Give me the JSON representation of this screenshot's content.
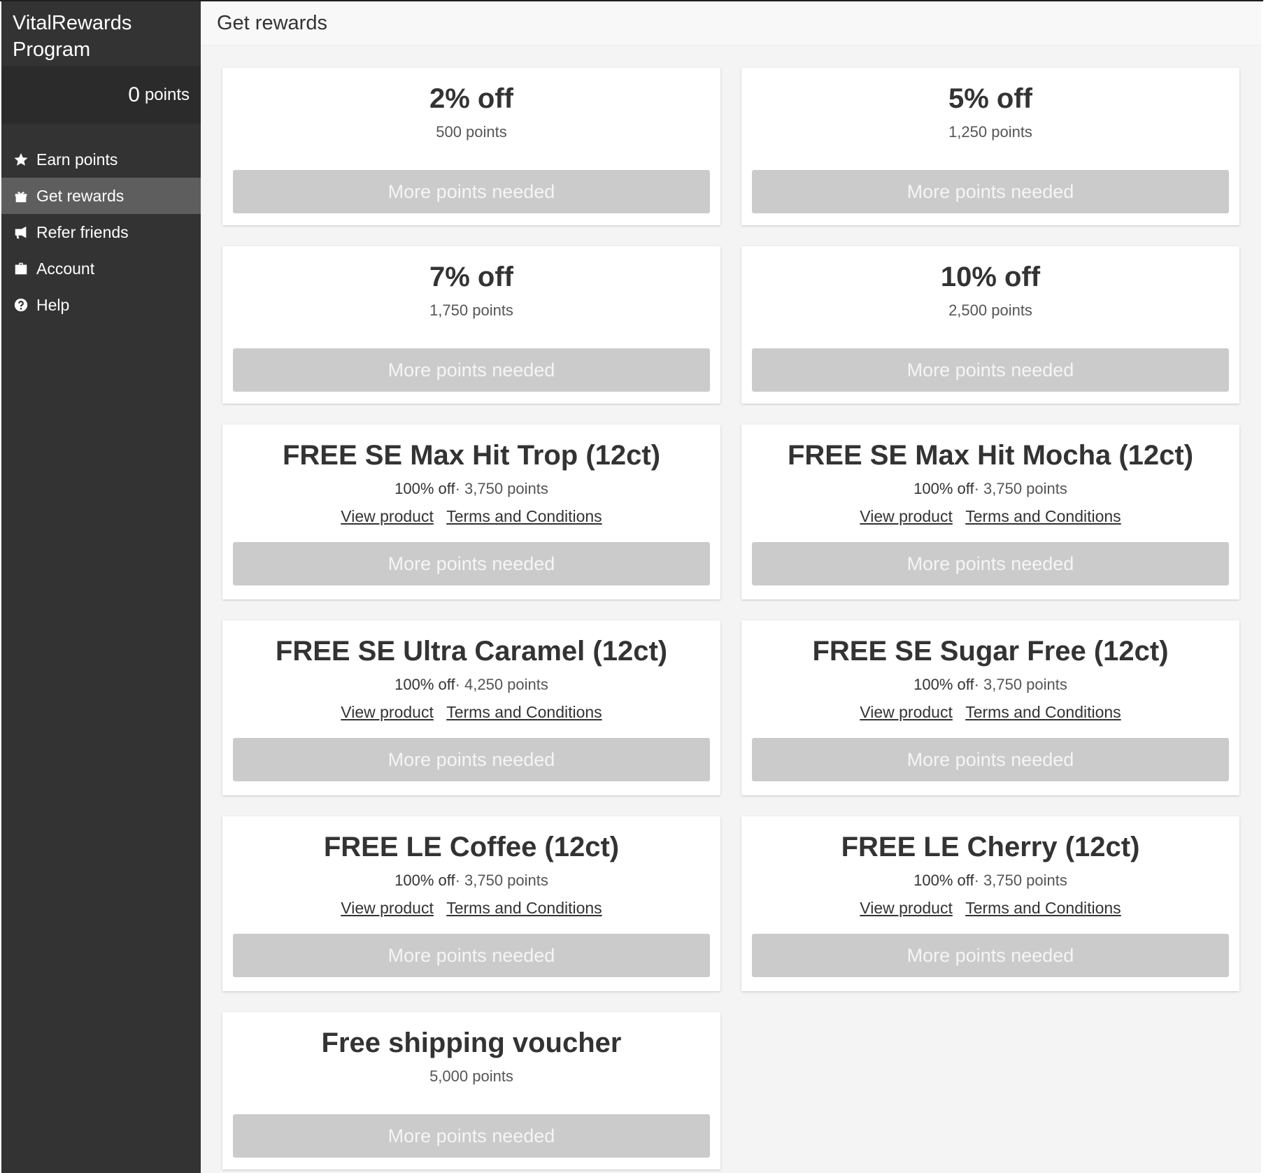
{
  "sidebar": {
    "brand": "VitalRewards Program",
    "points_value": "0",
    "points_label": "points",
    "nav": [
      {
        "label": "Earn points",
        "icon": "star-icon"
      },
      {
        "label": "Get rewards",
        "icon": "gift-icon",
        "active": true
      },
      {
        "label": "Refer friends",
        "icon": "megaphone-icon"
      },
      {
        "label": "Account",
        "icon": "briefcase-icon"
      },
      {
        "label": "Help",
        "icon": "question-circle-icon"
      }
    ]
  },
  "header": {
    "title": "Get rewards"
  },
  "common": {
    "button_label": "More points needed",
    "view_product": "View product",
    "terms": "Terms and Conditions"
  },
  "rewards": [
    {
      "title": "2% off",
      "points": "500 points"
    },
    {
      "title": "5% off",
      "points": "1,250 points"
    },
    {
      "title": "7% off",
      "points": "1,750 points"
    },
    {
      "title": "10% off",
      "points": "2,500 points"
    },
    {
      "title": "FREE SE Max Hit Trop (12ct)",
      "discount": "100% off",
      "points": "· 3,750 points"
    },
    {
      "title": "FREE SE Max Hit Mocha (12ct)",
      "discount": "100% off",
      "points": "· 3,750 points"
    },
    {
      "title": "FREE SE Ultra Caramel (12ct)",
      "discount": "100% off",
      "points": "· 4,250 points"
    },
    {
      "title": "FREE SE Sugar Free (12ct)",
      "discount": "100% off",
      "points": "· 3,750 points"
    },
    {
      "title": "FREE LE Coffee (12ct)",
      "discount": "100% off",
      "points": "· 3,750 points"
    },
    {
      "title": "FREE LE Cherry (12ct)",
      "discount": "100% off",
      "points": "· 3,750 points"
    },
    {
      "title": "Free shipping voucher",
      "points": "5,000 points"
    }
  ]
}
